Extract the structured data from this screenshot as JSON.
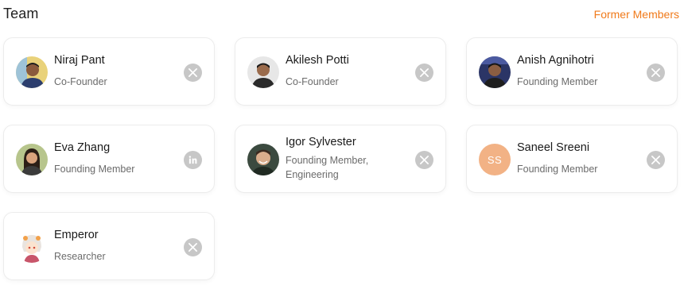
{
  "header": {
    "title": "Team",
    "former_link": "Former Members"
  },
  "colors": {
    "accent": "#f07a1a",
    "social_icon_bg": "#c7c7c7",
    "initials_bg": "#f2b285"
  },
  "members": [
    {
      "name": "Niraj Pant",
      "role": "Co-Founder",
      "social": "x-icon"
    },
    {
      "name": "Akilesh Potti",
      "role": "Co-Founder",
      "social": "x-icon"
    },
    {
      "name": "Anish Agnihotri",
      "role": "Founding Member",
      "social": "x-icon"
    },
    {
      "name": "Eva Zhang",
      "role": "Founding Member",
      "social": "linkedin-icon"
    },
    {
      "name": "Igor Sylvester",
      "role": "Founding Member,",
      "role_line2": "Engineering",
      "social": "x-icon"
    },
    {
      "name": "Saneel Sreeni",
      "role": "Founding Member",
      "initials": "SS",
      "social": "x-icon"
    },
    {
      "name": "Emperor",
      "role": "Researcher",
      "social": "x-icon"
    }
  ]
}
